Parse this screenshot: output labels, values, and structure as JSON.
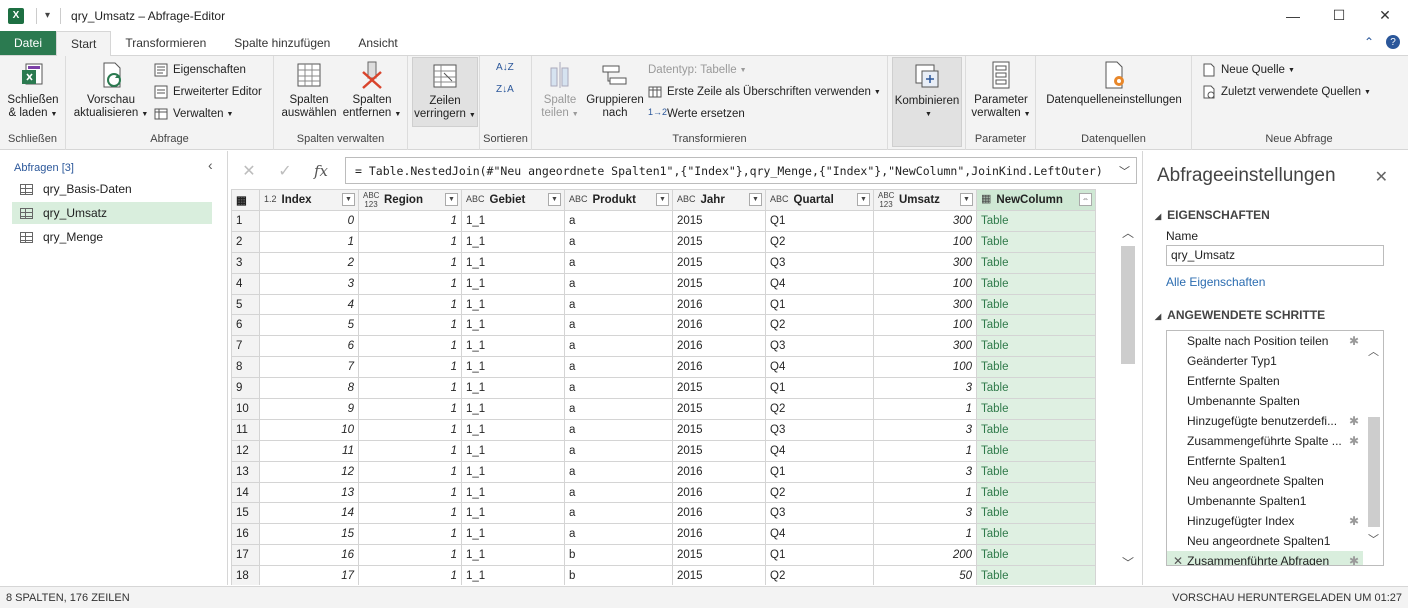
{
  "window": {
    "title": "qry_Umsatz – Abfrage-Editor",
    "app_icon": "X"
  },
  "tabs": [
    "Datei",
    "Start",
    "Transformieren",
    "Spalte hinzufügen",
    "Ansicht"
  ],
  "ribbon": {
    "close_load": "Schließen\n& laden",
    "close_load_l1": "Schließen",
    "close_load_l2": "& laden",
    "group_schliessen": "Schließen",
    "vorschau_l1": "Vorschau",
    "vorschau_l2": "aktualisieren",
    "eigenschaften": "Eigenschaften",
    "erweiterter_editor": "Erweiterter Editor",
    "verwalten": "Verwalten",
    "group_abfrage": "Abfrage",
    "spalten_auswaehlen_l1": "Spalten",
    "spalten_auswaehlen_l2": "auswählen",
    "spalten_entfernen_l1": "Spalten",
    "spalten_entfernen_l2": "entfernen",
    "group_spalten_verwalten": "Spalten verwalten",
    "zeilen_l1": "Zeilen",
    "zeilen_l2": "verringern",
    "group_sortieren": "Sortieren",
    "spalte_teilen_l1": "Spalte",
    "spalte_teilen_l2": "teilen",
    "gruppieren_l1": "Gruppieren",
    "gruppieren_l2": "nach",
    "datentyp": "Datentyp: Tabelle",
    "erste_zeile": "Erste Zeile als Überschriften verwenden",
    "werte_ersetzen": "Werte ersetzen",
    "group_transformieren": "Transformieren",
    "kombinieren": "Kombinieren",
    "parameter_l1": "Parameter",
    "parameter_l2": "verwalten",
    "group_parameter": "Parameter",
    "datenquellen": "Datenquelleneinstellungen",
    "group_datenquellen": "Datenquellen",
    "neue_quelle": "Neue Quelle",
    "zuletzt": "Zuletzt verwendete Quellen",
    "group_neue_abfrage": "Neue Abfrage"
  },
  "left_panel": {
    "header": "Abfragen [3]",
    "queries": [
      "qry_Basis-Daten",
      "qry_Umsatz",
      "qry_Menge"
    ],
    "selected_index": 1
  },
  "formula": "= Table.NestedJoin(#\"Neu angeordnete Spalten1\",{\"Index\"},qry_Menge,{\"Index\"},\"NewColumn\",JoinKind.LeftOuter)",
  "grid": {
    "columns": [
      {
        "type": "1.2",
        "name": "Index"
      },
      {
        "type": "ABC\n123",
        "name": "Region"
      },
      {
        "type": "ABC",
        "name": "Gebiet"
      },
      {
        "type": "ABC",
        "name": "Produkt"
      },
      {
        "type": "ABC",
        "name": "Jahr"
      },
      {
        "type": "ABC",
        "name": "Quartal"
      },
      {
        "type": "ABC\n123",
        "name": "Umsatz"
      },
      {
        "type": "table",
        "name": "NewColumn"
      }
    ],
    "rows": [
      [
        "1",
        "0",
        "1",
        "1_1",
        "a",
        "2015",
        "Q1",
        "300",
        "Table"
      ],
      [
        "2",
        "1",
        "1",
        "1_1",
        "a",
        "2015",
        "Q2",
        "100",
        "Table"
      ],
      [
        "3",
        "2",
        "1",
        "1_1",
        "a",
        "2015",
        "Q3",
        "300",
        "Table"
      ],
      [
        "4",
        "3",
        "1",
        "1_1",
        "a",
        "2015",
        "Q4",
        "100",
        "Table"
      ],
      [
        "5",
        "4",
        "1",
        "1_1",
        "a",
        "2016",
        "Q1",
        "300",
        "Table"
      ],
      [
        "6",
        "5",
        "1",
        "1_1",
        "a",
        "2016",
        "Q2",
        "100",
        "Table"
      ],
      [
        "7",
        "6",
        "1",
        "1_1",
        "a",
        "2016",
        "Q3",
        "300",
        "Table"
      ],
      [
        "8",
        "7",
        "1",
        "1_1",
        "a",
        "2016",
        "Q4",
        "100",
        "Table"
      ],
      [
        "9",
        "8",
        "1",
        "1_1",
        "a",
        "2015",
        "Q1",
        "3",
        "Table"
      ],
      [
        "10",
        "9",
        "1",
        "1_1",
        "a",
        "2015",
        "Q2",
        "1",
        "Table"
      ],
      [
        "11",
        "10",
        "1",
        "1_1",
        "a",
        "2015",
        "Q3",
        "3",
        "Table"
      ],
      [
        "12",
        "11",
        "1",
        "1_1",
        "a",
        "2015",
        "Q4",
        "1",
        "Table"
      ],
      [
        "13",
        "12",
        "1",
        "1_1",
        "a",
        "2016",
        "Q1",
        "3",
        "Table"
      ],
      [
        "14",
        "13",
        "1",
        "1_1",
        "a",
        "2016",
        "Q2",
        "1",
        "Table"
      ],
      [
        "15",
        "14",
        "1",
        "1_1",
        "a",
        "2016",
        "Q3",
        "3",
        "Table"
      ],
      [
        "16",
        "15",
        "1",
        "1_1",
        "a",
        "2016",
        "Q4",
        "1",
        "Table"
      ],
      [
        "17",
        "16",
        "1",
        "1_1",
        "b",
        "2015",
        "Q1",
        "200",
        "Table"
      ],
      [
        "18",
        "17",
        "1",
        "1_1",
        "b",
        "2015",
        "Q2",
        "50",
        "Table"
      ]
    ]
  },
  "right_panel": {
    "title": "Abfrageeinstellungen",
    "properties_header": "EIGENSCHAFTEN",
    "name_label": "Name",
    "name_value": "qry_Umsatz",
    "all_properties_link": "Alle Eigenschaften",
    "steps_header": "ANGEWENDETE SCHRITTE",
    "steps": [
      {
        "label": "Spalte nach Position teilen",
        "gear": true
      },
      {
        "label": "Geänderter Typ1",
        "gear": false
      },
      {
        "label": "Entfernte Spalten",
        "gear": false
      },
      {
        "label": "Umbenannte Spalten",
        "gear": false
      },
      {
        "label": "Hinzugefügte benutzerdefi...",
        "gear": true
      },
      {
        "label": "Zusammengeführte Spalte ...",
        "gear": true
      },
      {
        "label": "Entfernte Spalten1",
        "gear": false
      },
      {
        "label": "Neu angeordnete Spalten",
        "gear": false
      },
      {
        "label": "Umbenannte Spalten1",
        "gear": false
      },
      {
        "label": "Hinzugefügter Index",
        "gear": true
      },
      {
        "label": "Neu angeordnete Spalten1",
        "gear": false
      },
      {
        "label": "Zusammenführte Abfragen",
        "gear": true
      }
    ],
    "selected_step": 11
  },
  "status": {
    "left": "8 SPALTEN, 176 ZEILEN",
    "right": "VORSCHAU HERUNTERGELADEN UM 01:27"
  },
  "colors": {
    "accent_green": "#2b7a50",
    "selection_green": "#d9eedd",
    "link_blue": "#2b6cb0"
  }
}
